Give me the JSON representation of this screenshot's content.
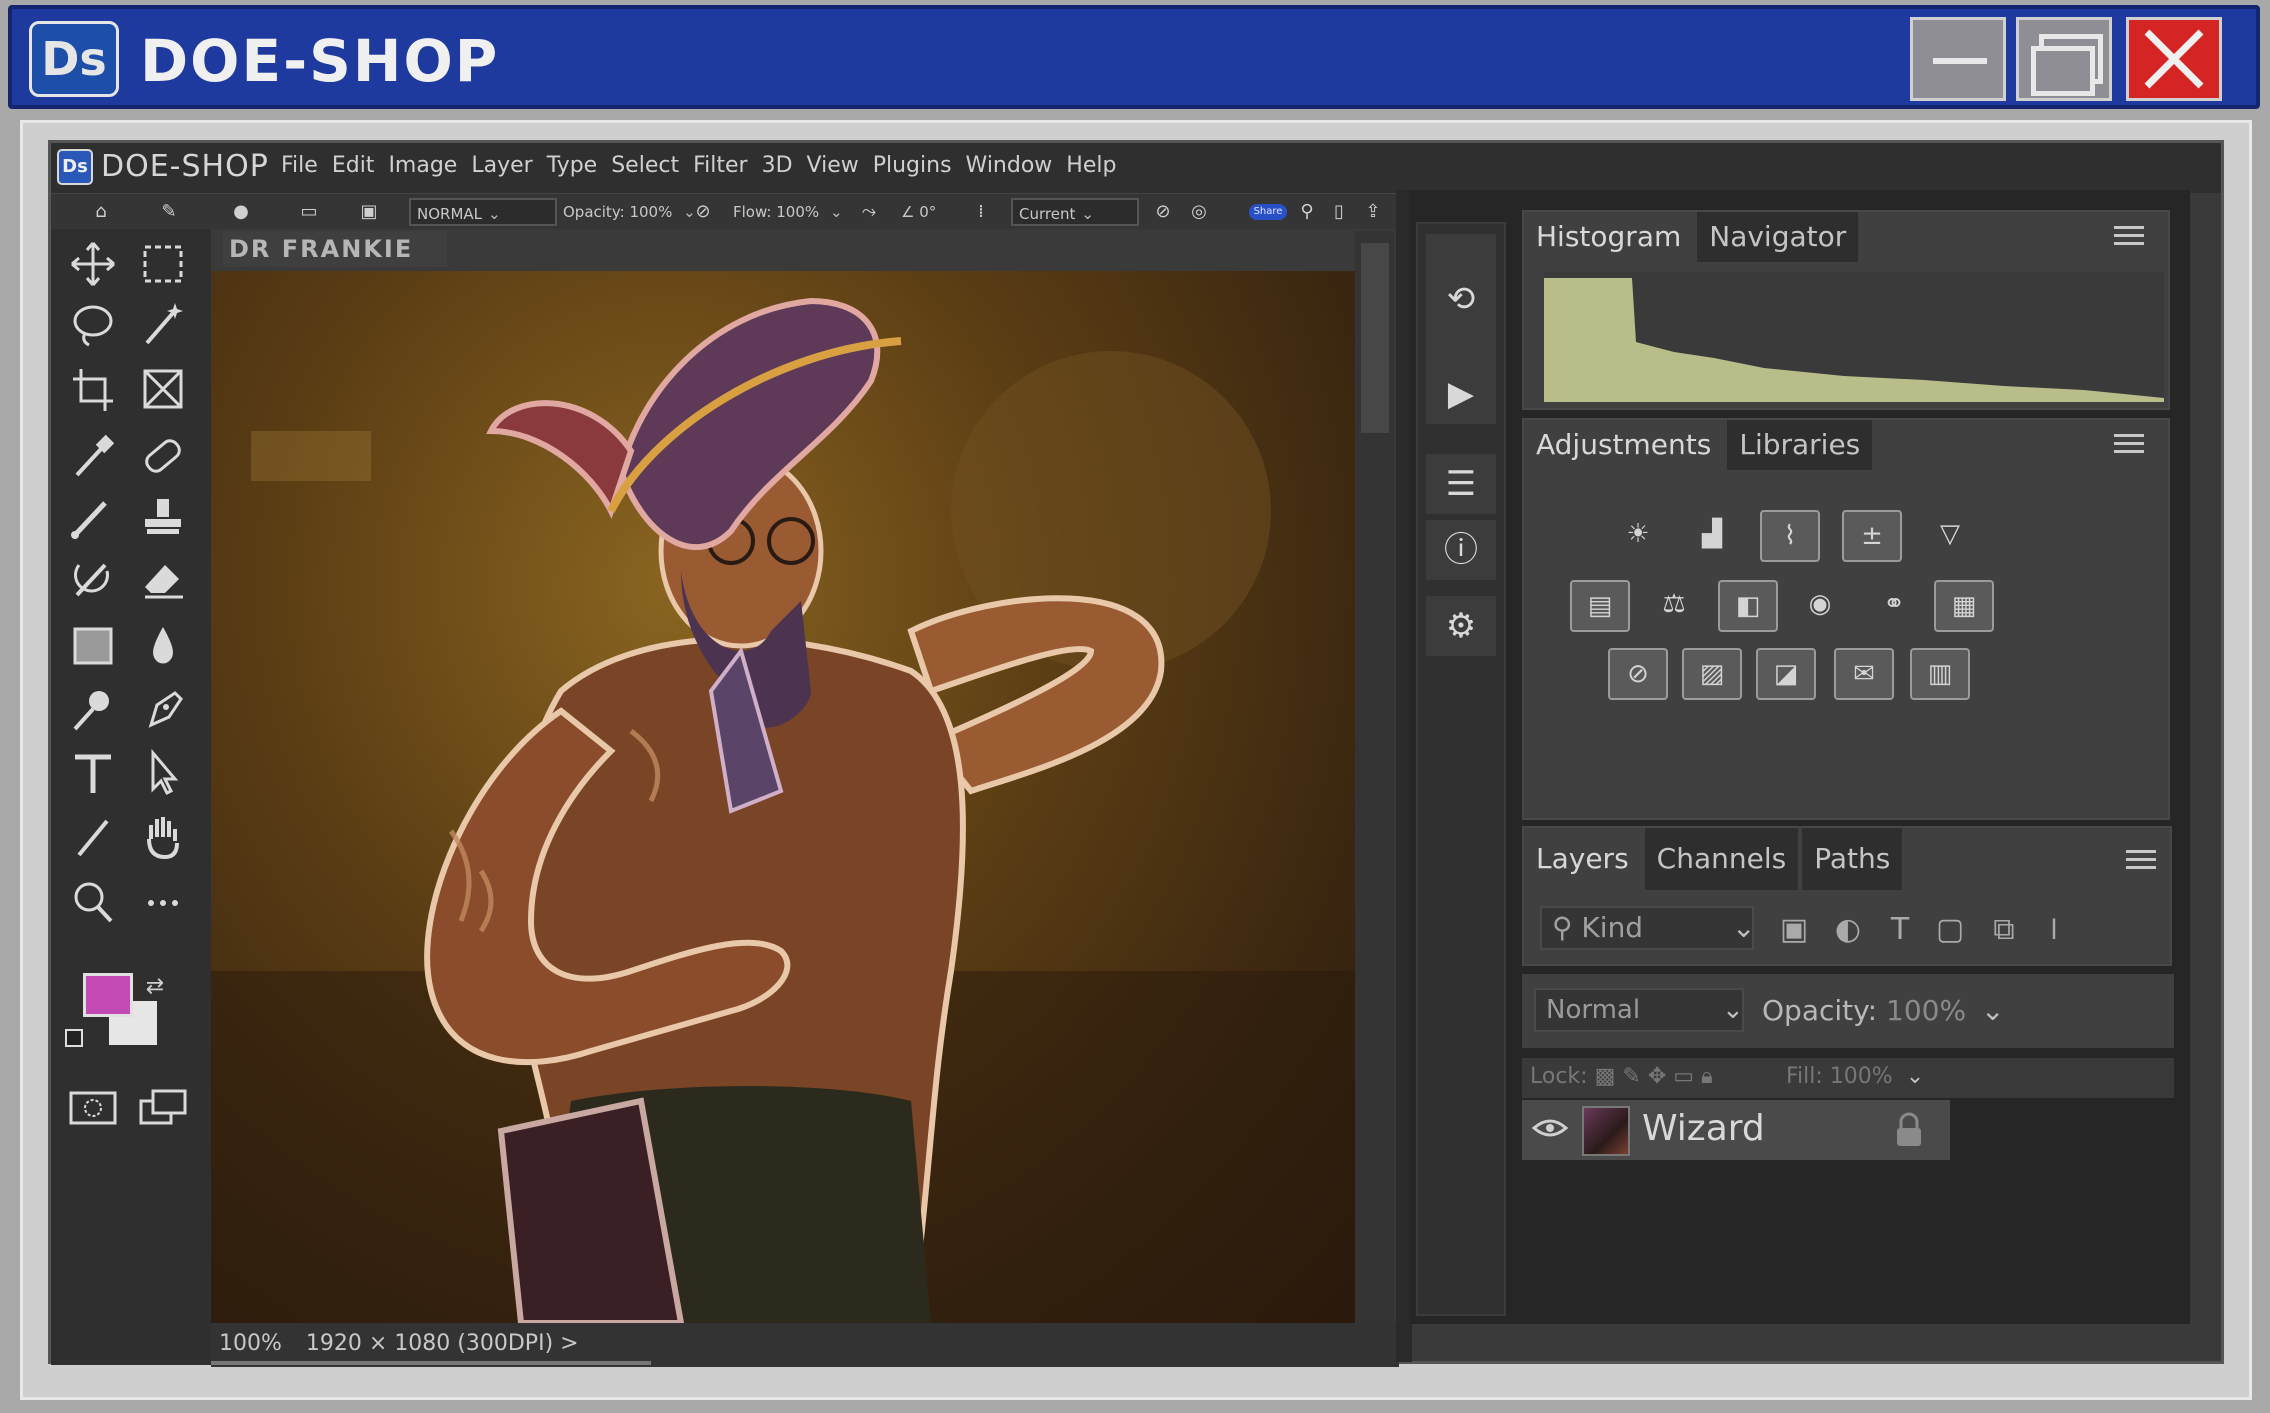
{
  "window": {
    "title": "DOE-SHOP",
    "logo_text": "Ds",
    "brand_color": "#1f3a9e",
    "close_color": "#d42424"
  },
  "app": {
    "logo_text": "Ds",
    "name": "DOE-SHOP",
    "menu": [
      "File",
      "Edit",
      "Image",
      "Layer",
      "Type",
      "Select",
      "Filter",
      "3D",
      "View",
      "Plugins",
      "Window",
      "Help"
    ]
  },
  "options_bar": {
    "mode": "NORMAL",
    "opacity_label": "Opacity:",
    "opacity_value": "100%",
    "flow_label": "Flow:",
    "flow_value": "100%",
    "angle_value": "0°",
    "sample": "Current",
    "share_label": "Share"
  },
  "document": {
    "tab_title": "DR FRANKIE",
    "zoom": "100%",
    "dimensions": "1920 × 1080 (300DPI)",
    "more_glyph": ">"
  },
  "tools": {
    "foreground_color": "#c34ab5",
    "background_color": "#e6e6e6"
  },
  "panels": {
    "top": {
      "tabs": [
        "Histogram",
        "Navigator"
      ],
      "active": 0
    },
    "middle": {
      "tabs": [
        "Adjustments",
        "Libraries"
      ],
      "active": 0
    },
    "bottom": {
      "tabs": [
        "Layers",
        "Channels",
        "Paths"
      ],
      "active": 0
    }
  },
  "layers": {
    "filter_placeholder": "Kind",
    "blend_mode": "Normal",
    "opacity_label": "Opacity:",
    "opacity_value": "100%",
    "lock_label": "Lock:",
    "fill_label": "Fill:",
    "fill_value": "100%",
    "items": [
      {
        "name": "Wizard"
      }
    ]
  }
}
